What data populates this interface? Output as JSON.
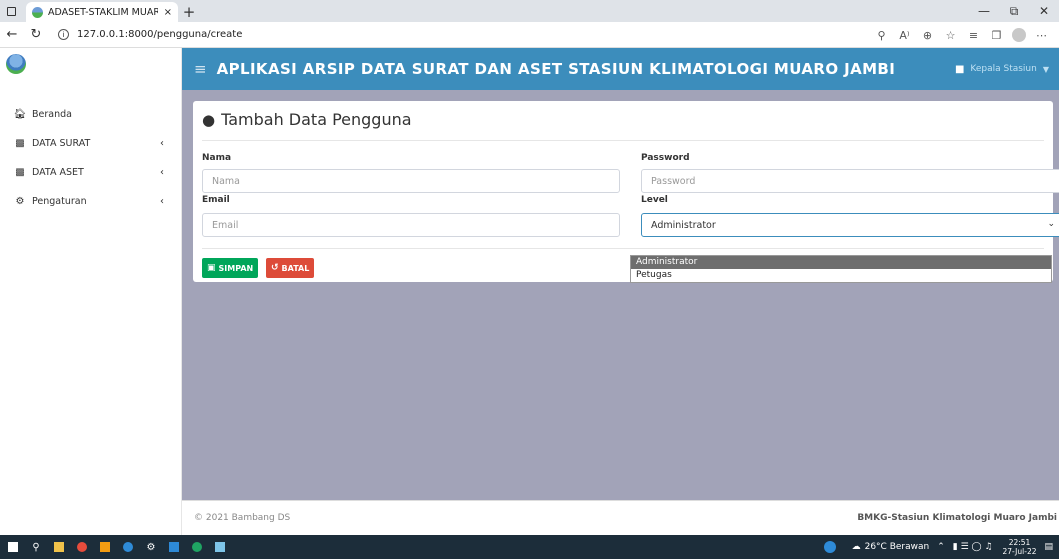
{
  "browser": {
    "tab_title": "ADASET-STAKLIM MUARO JAMBI",
    "tab_close": "×",
    "new_tab": "+",
    "url": "127.0.0.1:8000/pengguna/create"
  },
  "app": {
    "title": "APLIKASI ARSIP DATA SURAT DAN ASET STASIUN KLIMATOLOGI MUARO JAMBI",
    "user_label": "Kepala Stasiun",
    "accent_color": "#3c8dbc"
  },
  "sidebar": {
    "items": [
      {
        "label": "Beranda",
        "icon": "home-icon"
      },
      {
        "label": "DATA SURAT",
        "icon": "users-icon"
      },
      {
        "label": "DATA ASET",
        "icon": "users-icon"
      },
      {
        "label": "Pengaturan",
        "icon": "gears-icon"
      }
    ]
  },
  "form": {
    "title": "Tambah Data Pengguna",
    "nama_label": "Nama",
    "nama_placeholder": "Nama",
    "password_label": "Password",
    "password_placeholder": "Password",
    "email_label": "Email",
    "email_placeholder": "Email",
    "level_label": "Level",
    "level_value": "Administrator",
    "level_options": [
      "Administrator",
      "Petugas"
    ],
    "save_label": "SIMPAN",
    "cancel_label": "BATAL"
  },
  "footer": {
    "copyright": "© 2021 Bambang DS",
    "org": "BMKG-Stasiun Klimatologi Muaro Jambi"
  },
  "taskbar": {
    "weather": "26°C Berawan",
    "time": "22:51",
    "date": "27-Jul-22"
  }
}
